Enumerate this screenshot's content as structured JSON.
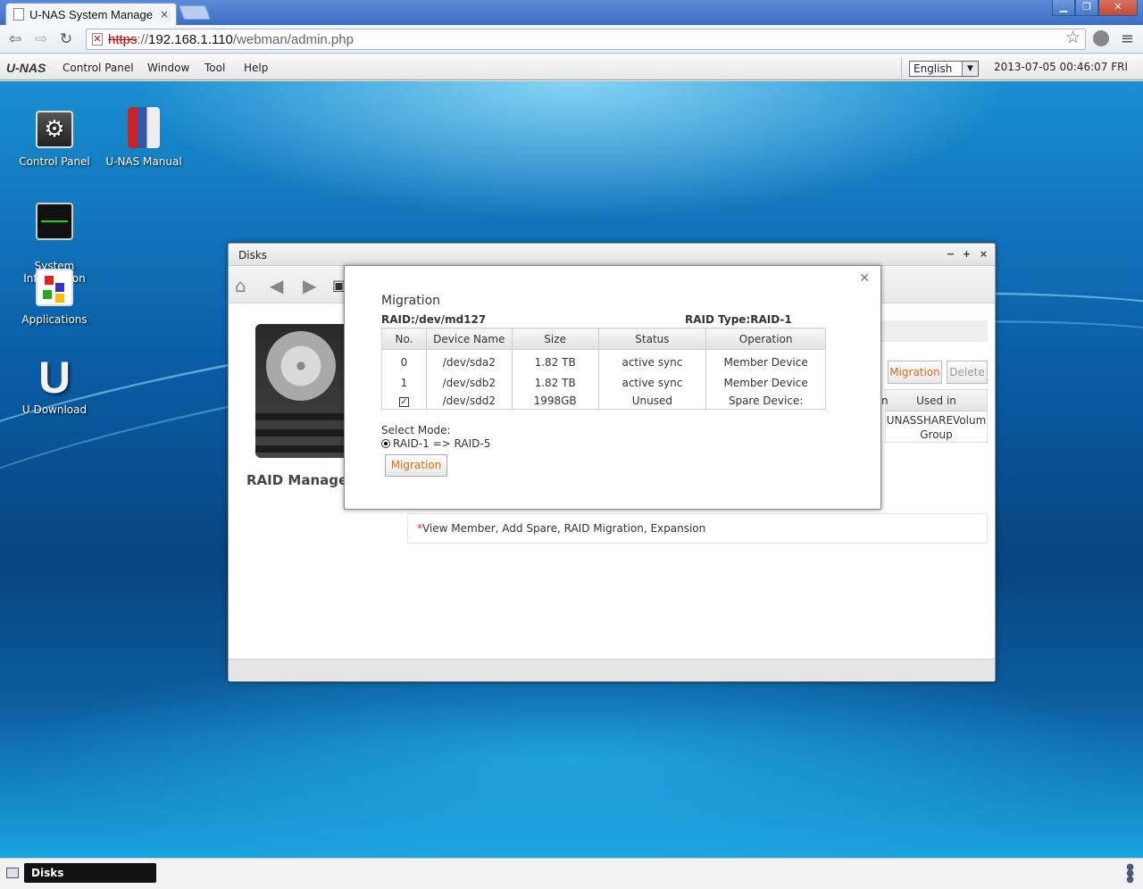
{
  "browser": {
    "tab_title": "U-NAS System Manage",
    "tab_close": "×",
    "url_protocol": "https",
    "url_sep": "://",
    "url_host": "192.168.1.110",
    "url_path": "/webman/admin.php"
  },
  "menubar": {
    "logo": "U-NAS",
    "items": [
      "Control Panel",
      "Window",
      "Tool",
      "Help"
    ],
    "language": "English",
    "datetime": "2013-07-05 00:46:07 FRI"
  },
  "desktop": {
    "icons": [
      {
        "label": "Control Panel",
        "icon": "gear-icon"
      },
      {
        "label": "U-NAS Manual",
        "icon": "book-icon"
      },
      {
        "label": "System\nInformation",
        "icon": "monitor-icon"
      },
      {
        "label": "Applications",
        "icon": "apps-icon"
      },
      {
        "label": "U Download",
        "icon": "download-icon"
      }
    ]
  },
  "window": {
    "title": "Disks",
    "raid_title": "RAID Managem",
    "buttons": {
      "migration": "Migration",
      "delete": "Delete"
    },
    "bg_table": {
      "header": "Used in",
      "cell_line1": "UNASSHAREVolum",
      "cell_line2": "Group",
      "edge": "n"
    },
    "note_star": "*",
    "note": "View Member, Add Spare, RAID Migration, Expansion"
  },
  "dialog": {
    "title": "Migration",
    "raid": "RAID:/dev/md127",
    "raid_type": "RAID Type:RAID-1",
    "columns": [
      "No.",
      "Device Name",
      "Size",
      "Status",
      "Operation"
    ],
    "rows": [
      {
        "no": "0",
        "device": "/dev/sda2",
        "size": "1.82 TB",
        "status": "active sync",
        "operation": "Member Device"
      },
      {
        "no": "1",
        "device": "/dev/sdb2",
        "size": "1.82 TB",
        "status": "active sync",
        "operation": "Member Device"
      },
      {
        "no": "",
        "device": "/dev/sdd2",
        "size": "1998GB",
        "status": "Unused",
        "operation": "Spare Device:",
        "checked": true
      }
    ],
    "select_mode_label": "Select Mode:",
    "mode_option": "RAID-1 => RAID-5",
    "migrate_button": "Migration"
  },
  "taskbar": {
    "task": "Disks"
  }
}
